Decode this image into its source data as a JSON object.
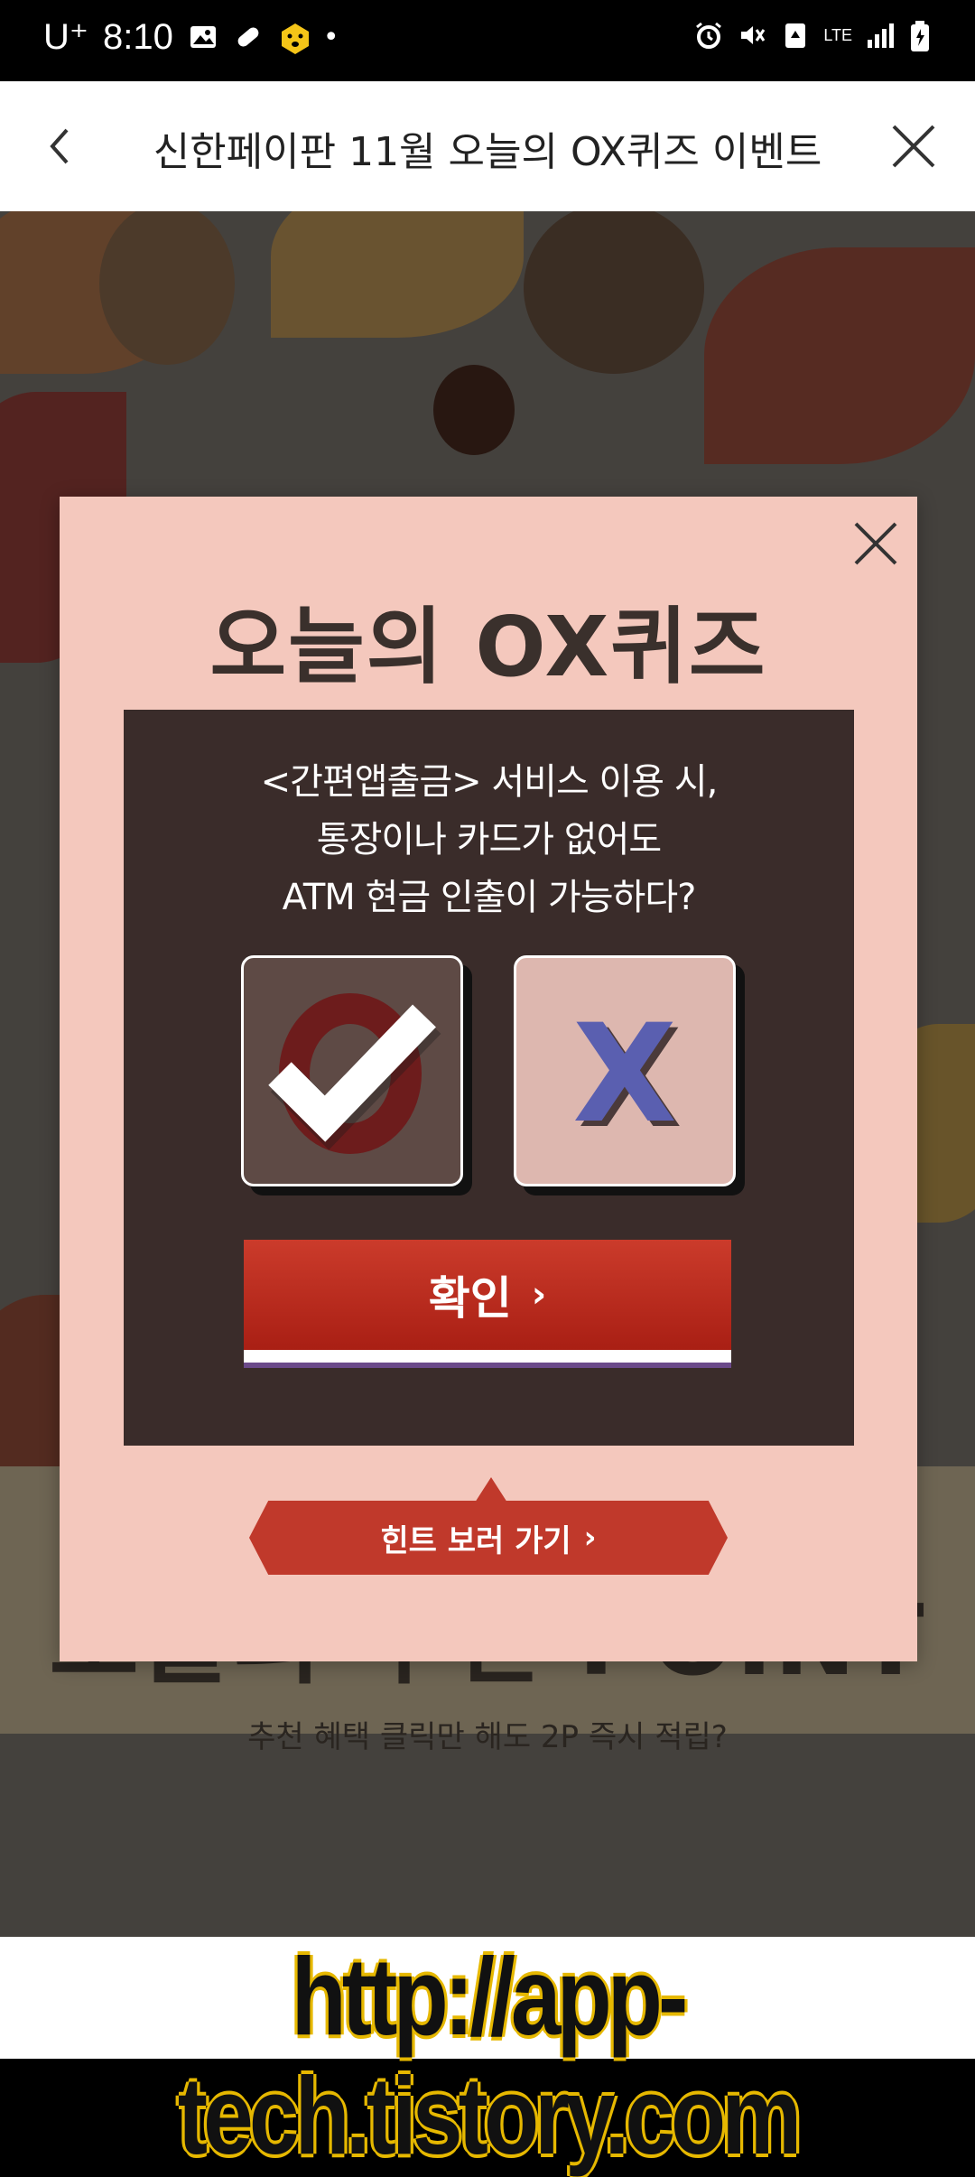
{
  "status_bar": {
    "carrier": "U⁺",
    "time": "8:10",
    "network": "LTE"
  },
  "header": {
    "title": "신한페이판 11월 오늘의 OX퀴즈 이벤트"
  },
  "modal": {
    "title": "오늘의 OX퀴즈",
    "question_lines": [
      "<간편앱출금> 서비스 이용 시,",
      "통장이나 카드가 없어도",
      "ATM 현금 인출이 가능하다?"
    ],
    "choices": {
      "o_selected": true,
      "x_label": "X"
    },
    "confirm_label": "확인",
    "hint_label": "힌트 보러 가기"
  },
  "background": {
    "section_title": "오늘의 추천 POINT",
    "section_subtitle": "추천 혜택 클릭만 해도 2P 즉시 적립?"
  },
  "watermark": "http://app-tech.tistory.com",
  "colors": {
    "modal_bg": "#f4c8bd",
    "quiz_box": "#3a2c2a",
    "accent_red": "#c0392b",
    "x_blue": "#5a5fb0"
  }
}
